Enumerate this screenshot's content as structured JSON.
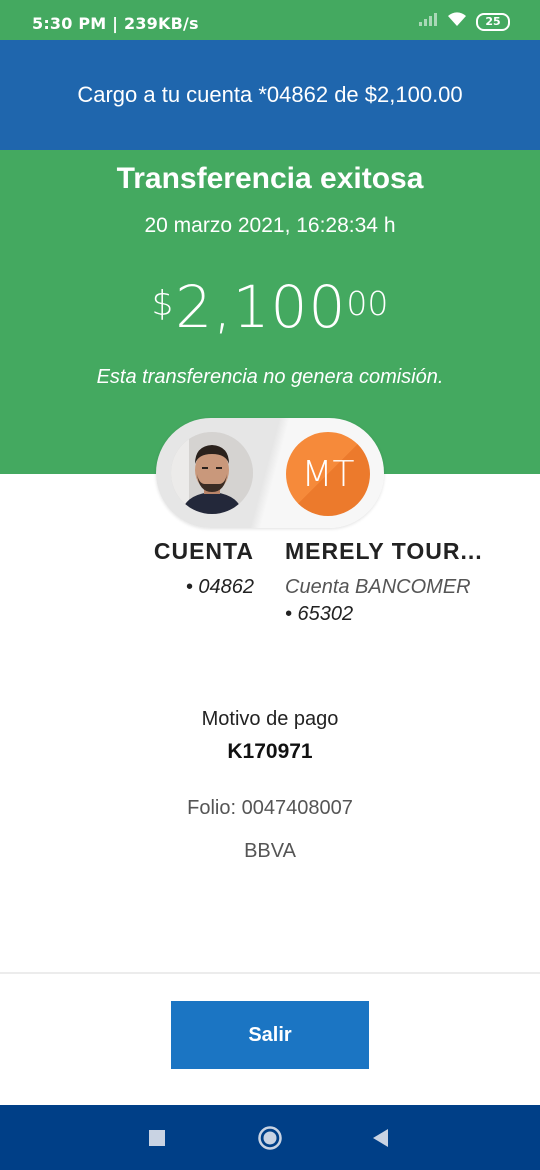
{
  "status_bar": {
    "time_speed": "5:30 PM | 239KB/s",
    "battery": "25",
    "icons": [
      "signal-icon",
      "wifi-icon",
      "battery-icon"
    ]
  },
  "header": {
    "text": "Cargo a tu cuenta *04862 de $2,100.00"
  },
  "success": {
    "title": "Transferencia exitosa",
    "datetime": "20 marzo 2021, 16:28:34 h",
    "amount_currency": "$",
    "amount_main": "2,100",
    "amount_cents": "00",
    "commission_note": "Esta transferencia no genera comisión."
  },
  "from": {
    "name": "CUENTA",
    "account": "• 04862"
  },
  "to": {
    "initials": "MT",
    "name": "MERELY TOUR...",
    "bank": "Cuenta BANCOMER",
    "account": "• 65302"
  },
  "details": {
    "motivo_label": "Motivo de pago",
    "motivo_value": "K170971",
    "folio": "Folio: 0047408007",
    "bank": "BBVA"
  },
  "actions": {
    "exit_label": "Salir"
  },
  "colors": {
    "header_blue": "#1f66ad",
    "success_green": "#44a960",
    "button_blue": "#1b75c3",
    "nav_blue": "#003f87",
    "avatar_orange": "#f68a3a"
  },
  "nav": {
    "icons": [
      "recents-square-icon",
      "home-circle-icon",
      "back-triangle-icon"
    ]
  }
}
